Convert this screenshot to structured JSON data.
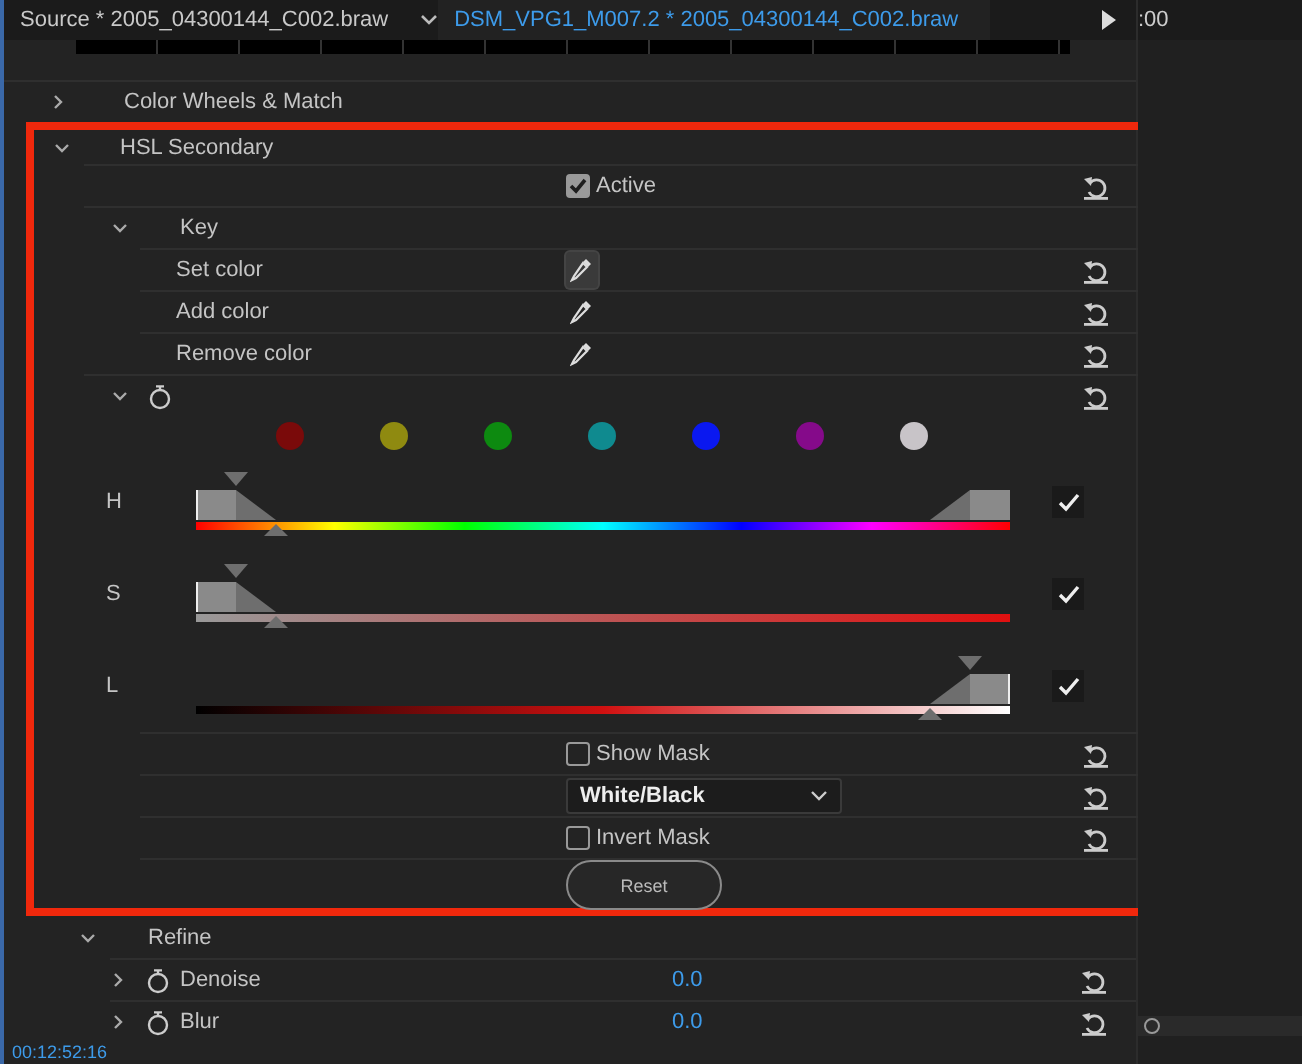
{
  "tabs": [
    {
      "label": "Source * 2005_04300144_C002.braw",
      "selected": false
    },
    {
      "label": "DSM_VPG1_M007.2 * 2005_04300144_C002.braw",
      "selected": true
    }
  ],
  "timeline": {
    "time_label": ":00"
  },
  "color_wheels": {
    "label": "Color Wheels & Match",
    "expanded": false
  },
  "hsl_secondary": {
    "label": "HSL Secondary",
    "expanded": true,
    "active": {
      "label": "Active",
      "checked": true
    },
    "key": {
      "label": "Key",
      "expanded": true,
      "items": [
        {
          "label": "Set color",
          "selected": true
        },
        {
          "label": "Add color",
          "selected": false
        },
        {
          "label": "Remove color",
          "selected": false
        }
      ],
      "swatches": [
        {
          "color": "#7a0a0a"
        },
        {
          "color": "#8f8a10"
        },
        {
          "color": "#0d8a10"
        },
        {
          "color": "#0f8a8f"
        },
        {
          "color": "#0a18f0"
        },
        {
          "color": "#850a8a"
        },
        {
          "color": "#c8c4c8"
        }
      ],
      "sliders": [
        {
          "label": "H",
          "kind": "hue",
          "checked": true,
          "handles": [
            {
              "kind": "low",
              "level": 0.05,
              "selected": true
            },
            {
              "kind": "high",
              "level": 0.95,
              "selected": false
            }
          ]
        },
        {
          "label": "S",
          "kind": "saturation",
          "checked": true,
          "handles": [
            {
              "kind": "low",
              "level": 0.05,
              "selected": true
            }
          ]
        },
        {
          "label": "L",
          "kind": "lightness",
          "checked": true,
          "handles": [
            {
              "kind": "high",
              "level": 0.95,
              "selected": true
            }
          ]
        }
      ]
    },
    "show_mask": {
      "label": "Show Mask",
      "checked": false
    },
    "mask_mode": "White/Black",
    "invert_mask": {
      "label": "Invert Mask",
      "checked": false
    },
    "reset_button": "Reset"
  },
  "refine": {
    "label": "Refine",
    "expanded": true,
    "items": [
      {
        "label": "Denoise",
        "value": "0.0",
        "expanded": false
      },
      {
        "label": "Blur",
        "value": "0.0",
        "expanded": false
      }
    ]
  },
  "status_bar": {
    "timecode": "00:12:52:16"
  }
}
